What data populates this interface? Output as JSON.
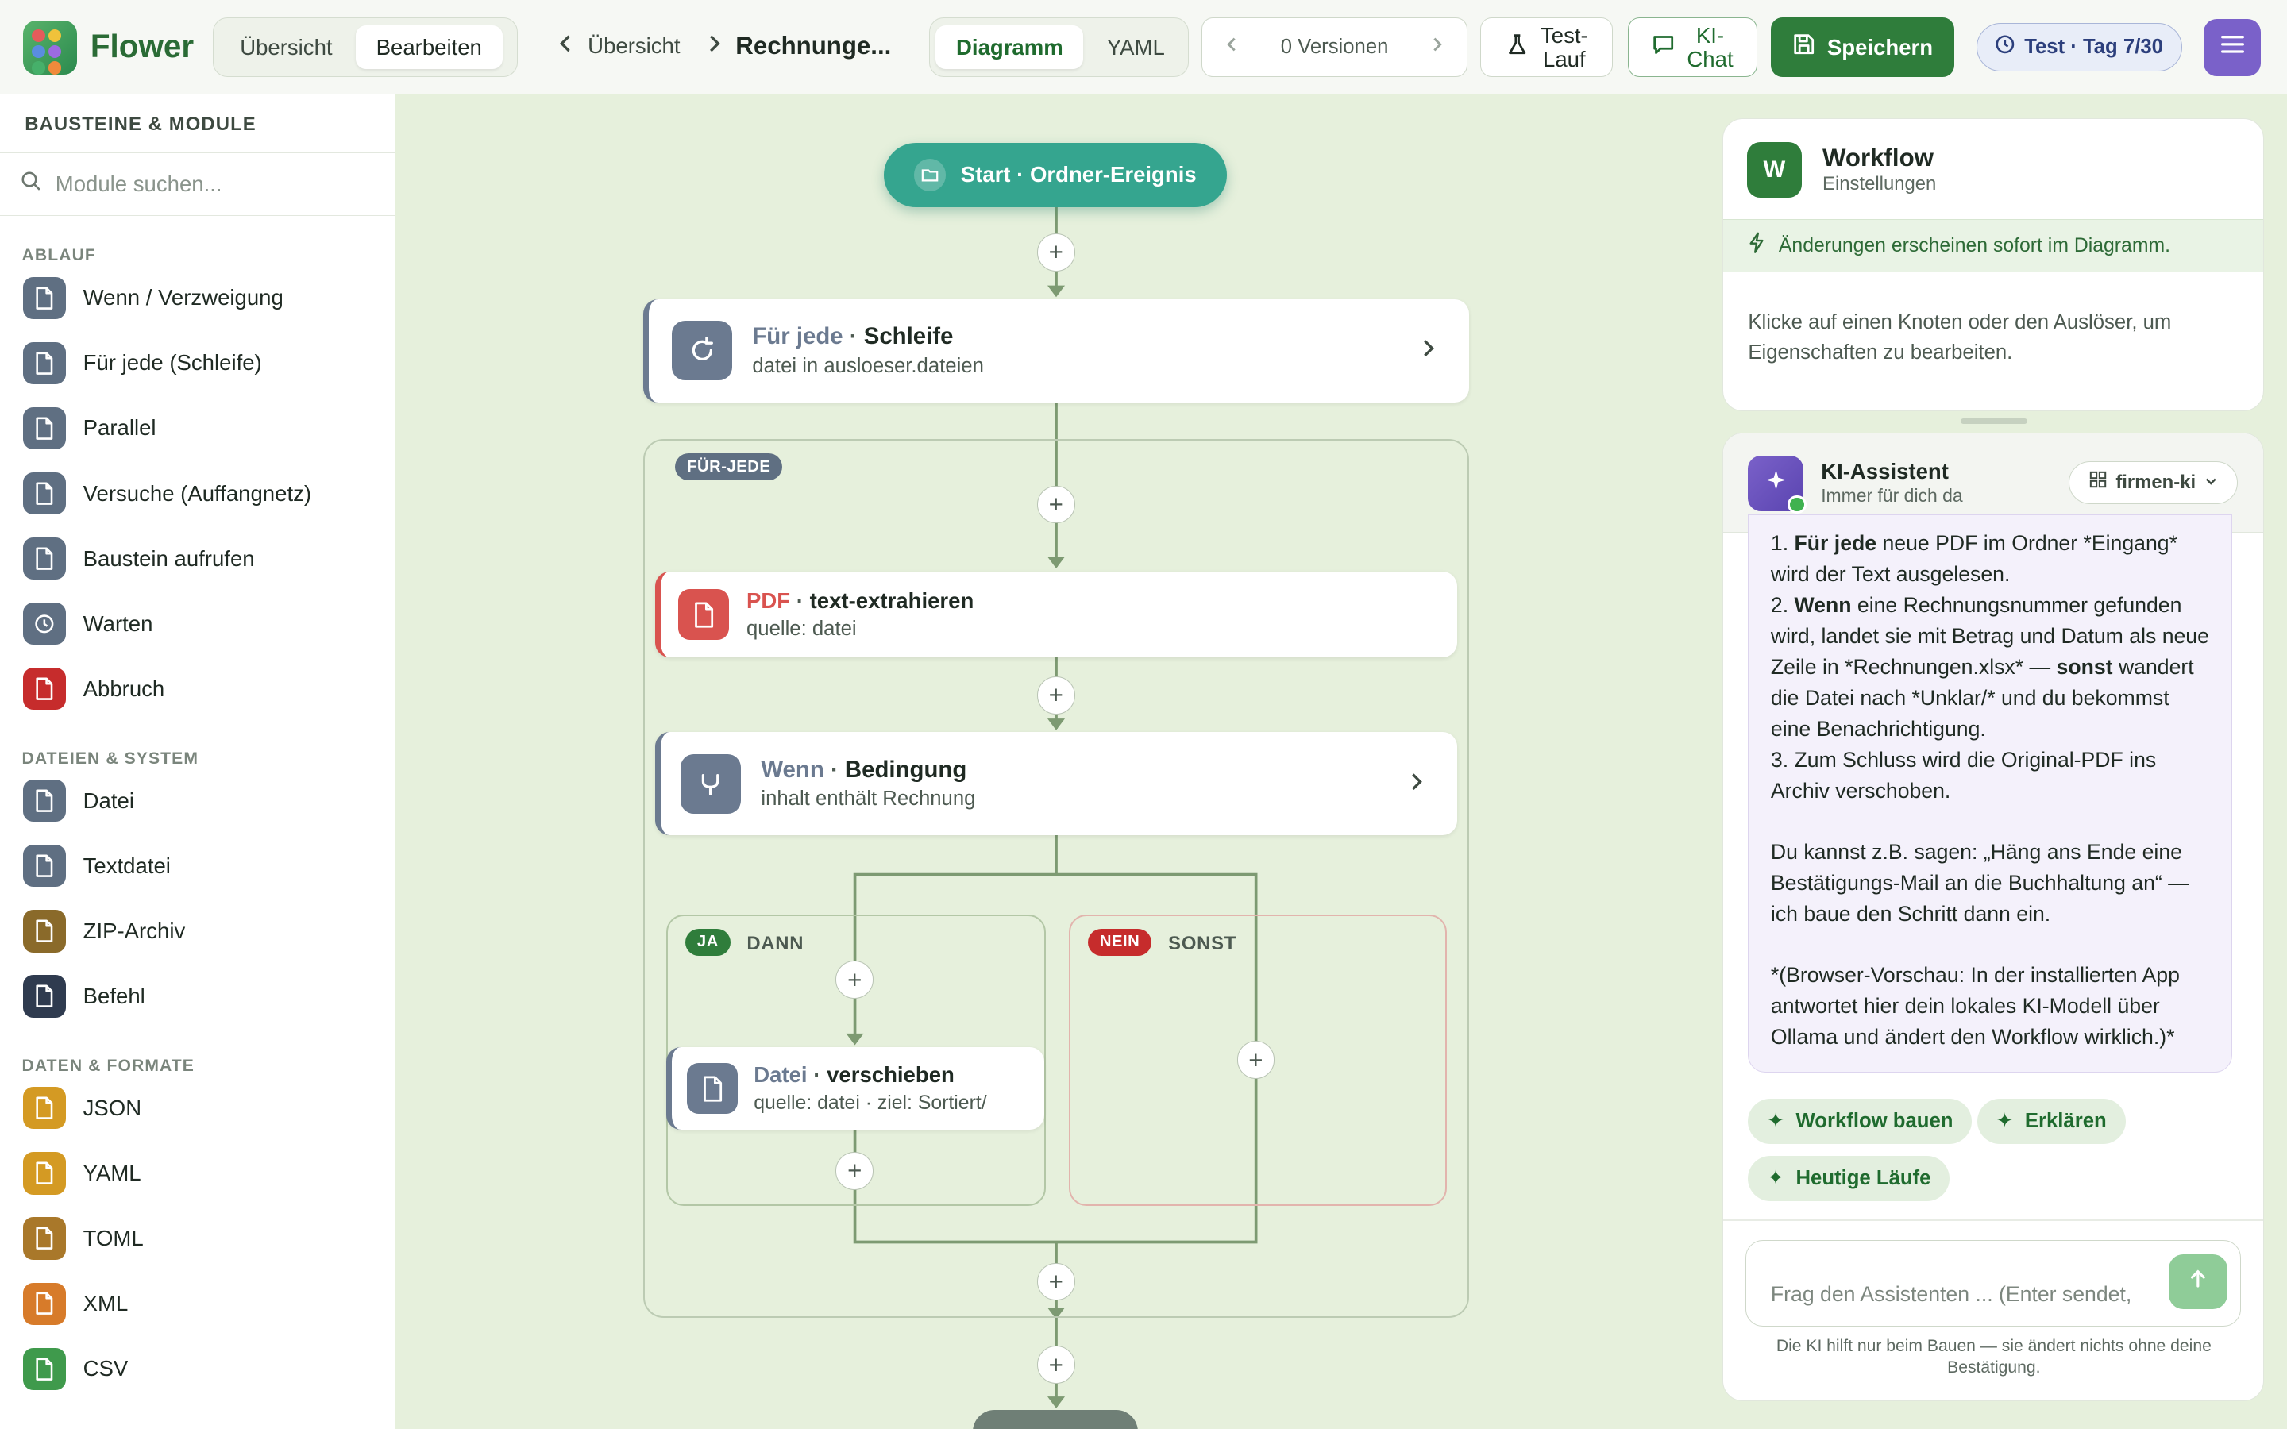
{
  "app": {
    "name": "Flower"
  },
  "header": {
    "view_tabs": [
      "Übersicht",
      "Bearbeiten"
    ],
    "breadcrumb": {
      "back": "Übersicht",
      "current": "Rechnunge..."
    },
    "mode_tabs": [
      "Diagramm",
      "YAML"
    ],
    "versions": "0 Versionen",
    "test_run": "Test-\nLauf",
    "ai_chat": "KI-\nChat",
    "save": "Speichern",
    "trial": "Test · Tag 7/30"
  },
  "sidebar": {
    "title": "BAUSTEINE & MODULE",
    "search_placeholder": "Module suchen...",
    "sections": [
      {
        "title": "ABLAUF",
        "items": [
          {
            "label": "Wenn / Verzweigung",
            "color": "#5f6f82",
            "icon": "file-icon"
          },
          {
            "label": "Für jede (Schleife)",
            "color": "#5f6f82",
            "icon": "file-icon"
          },
          {
            "label": "Parallel",
            "color": "#5f6f82",
            "icon": "file-icon"
          },
          {
            "label": "Versuche (Auffangnetz)",
            "color": "#5f6f82",
            "icon": "file-icon"
          },
          {
            "label": "Baustein aufrufen",
            "color": "#5f6f82",
            "icon": "file-icon"
          },
          {
            "label": "Warten",
            "color": "#5f6f82",
            "icon": "clock-icon"
          },
          {
            "label": "Abbruch",
            "color": "#c62c2c",
            "icon": "file-icon"
          }
        ]
      },
      {
        "title": "DATEIEN & SYSTEM",
        "items": [
          {
            "label": "Datei",
            "color": "#5f6f82",
            "icon": "file-icon"
          },
          {
            "label": "Textdatei",
            "color": "#5f6f82",
            "icon": "file-icon"
          },
          {
            "label": "ZIP-Archiv",
            "color": "#8a6a2a",
            "icon": "file-icon"
          },
          {
            "label": "Befehl",
            "color": "#2f3b4f",
            "icon": "file-icon"
          }
        ]
      },
      {
        "title": "DATEN & FORMATE",
        "items": [
          {
            "label": "JSON",
            "color": "#d49a23",
            "icon": "file-icon"
          },
          {
            "label": "YAML",
            "color": "#d49a23",
            "icon": "file-icon"
          },
          {
            "label": "TOML",
            "color": "#a9782a",
            "icon": "file-icon"
          },
          {
            "label": "XML",
            "color": "#d77b2a",
            "icon": "file-icon"
          },
          {
            "label": "CSV",
            "color": "#3f9a4c",
            "icon": "file-icon"
          }
        ]
      }
    ]
  },
  "diagram": {
    "start": "Start · Ordner-Ereignis",
    "loop": {
      "kind": "Für jede",
      "sep": "·",
      "title": "Schleife",
      "detail": "datei in ausloeser.dateien"
    },
    "loop_tag": "FÜR-JEDE",
    "pdf": {
      "kind": "PDF",
      "sep": "·",
      "title": "text-extrahieren",
      "detail": "quelle: datei"
    },
    "cond": {
      "kind": "Wenn",
      "sep": "·",
      "title": "Bedingung",
      "detail": "inhalt enthält Rechnung"
    },
    "yes_tag": "JA",
    "yes_label": "DANN",
    "no_tag": "NEIN",
    "no_label": "SONST",
    "move": {
      "kind": "Datei",
      "sep": "·",
      "title": "verschieben",
      "detail": "quelle: datei · ziel: Sortiert/"
    }
  },
  "workflow_panel": {
    "avatar": "W",
    "title": "Workflow",
    "subtitle": "Einstellungen",
    "notice": "Änderungen erscheinen sofort im Diagramm.",
    "hint": "Klicke auf einen Knoten oder den Auslöser, um Eigenschaften zu bearbeiten."
  },
  "assistant": {
    "title": "KI-Assistent",
    "subtitle": "Immer für dich da",
    "model": "firmen-ki",
    "message": {
      "l1a": "1. ",
      "l1b": "Für jede",
      "l1c": " neue PDF im Ordner *Eingang* wird der Text ausgelesen.",
      "l2a": "2. ",
      "l2b": "Wenn",
      "l2c": " eine Rechnungsnummer gefunden wird, landet sie mit Betrag und Datum als neue Zeile in *Rechnungen.xlsx* — ",
      "l2d": "sonst",
      "l2e": " wandert die Datei nach *Unklar/* und du bekommst eine Benachrichtigung.",
      "l3": "3. Zum Schluss wird die Original-PDF ins Archiv verschoben.",
      "p2": "Du kannst z.B. sagen: „Häng ans Ende eine Bestätigungs-Mail an die Buchhaltung an“ — ich baue den Schritt dann ein.",
      "p3": "*(Browser-Vorschau: In der installierten App antwortet hier dein lokales KI-Modell über Ollama und ändert den Workflow wirklich.)*"
    },
    "suggestions": [
      "Workflow bauen",
      "Erklären",
      "Heutige Läufe"
    ],
    "input_placeholder": "Frag den Assistenten ... (Enter sendet,",
    "footer": "Die KI hilft nur beim Bauen — sie ändert nichts ohne deine Bestätigung."
  }
}
